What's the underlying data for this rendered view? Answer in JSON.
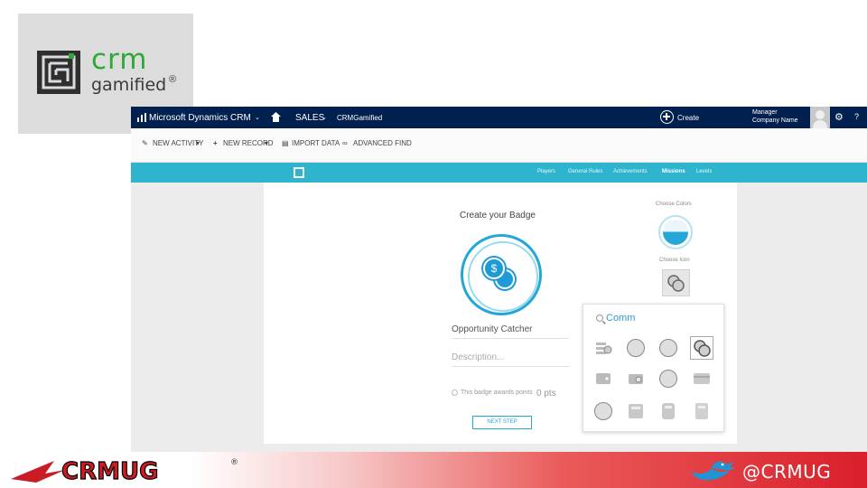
{
  "brand": {
    "logo_text": "crm",
    "logo_sub": "gamified",
    "logo_mark": "®"
  },
  "topbar": {
    "app_title": "Microsoft Dynamics CRM",
    "area": "SALES",
    "entity": "CRMGamified",
    "create_label": "Create",
    "user_name": "Manager",
    "user_org": "Company Name",
    "help_label": "?"
  },
  "commands": {
    "new_activity": "NEW ACTIVITY",
    "new_record": "NEW RECORD",
    "import_data": "IMPORT DATA",
    "advanced_find": "ADVANCED FIND"
  },
  "nav": {
    "items": [
      "Players",
      "General Rules",
      "Achievements",
      "Missions",
      "Levels"
    ],
    "active": "Missions"
  },
  "badge": {
    "heading": "Create your Badge",
    "name_value": "Opportunity Catcher",
    "description_placeholder": "Description...",
    "points_label": "This badge awards points",
    "points_value": "0 pts",
    "next_label": "NEXT STEP",
    "choose_colors": "Choose Colors",
    "choose_icon": "Choose Icon",
    "accent_color": "#22a7d8"
  },
  "icon_picker": {
    "search_value": "Comm",
    "icons": [
      "coins-stack-icon",
      "coin-icon",
      "dollar-coin-icon",
      "coins-icon",
      "wallet-icon",
      "wallet-coin-icon",
      "coin-outline-icon",
      "card-icon",
      "pie-chart-icon",
      "calculator-icon",
      "calculator-alt-icon",
      "calculator-grid-icon"
    ]
  },
  "footer": {
    "org_logo": "CRMUG",
    "handle": "@CRMUG",
    "reg_mark": "®"
  }
}
